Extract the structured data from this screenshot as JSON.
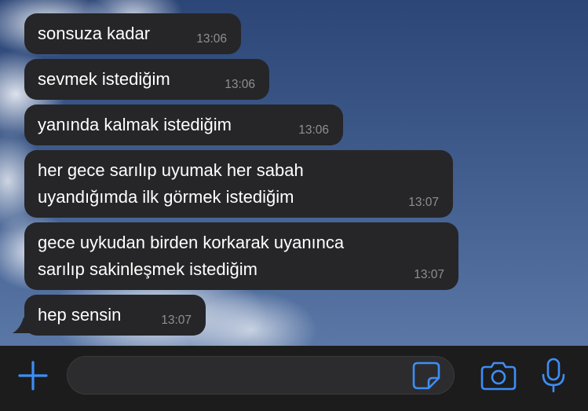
{
  "messages": [
    {
      "text": "sonsuza kadar",
      "time": "13:06"
    },
    {
      "text": "sevmek istediğim",
      "time": "13:06"
    },
    {
      "text": "yanında kalmak istediğim",
      "time": "13:06"
    },
    {
      "text": "her gece sarılıp uyumak her sabah\nuyandığımda ilk görmek istediğim",
      "time": "13:07"
    },
    {
      "text": "gece uykudan birden korkarak uyanınca\nsarılıp sakinleşmek istediğim",
      "time": "13:07"
    },
    {
      "text": "hep sensin",
      "time": "13:07"
    }
  ],
  "input": {
    "value": "",
    "placeholder": ""
  },
  "icons": {
    "add": "plus-icon",
    "sticker": "sticker-icon",
    "camera": "camera-icon",
    "mic": "microphone-icon"
  },
  "colors": {
    "accent": "#3d8ef7",
    "bubble": "#262628",
    "time": "#8e8e93",
    "bar": "#1c1c1d"
  }
}
